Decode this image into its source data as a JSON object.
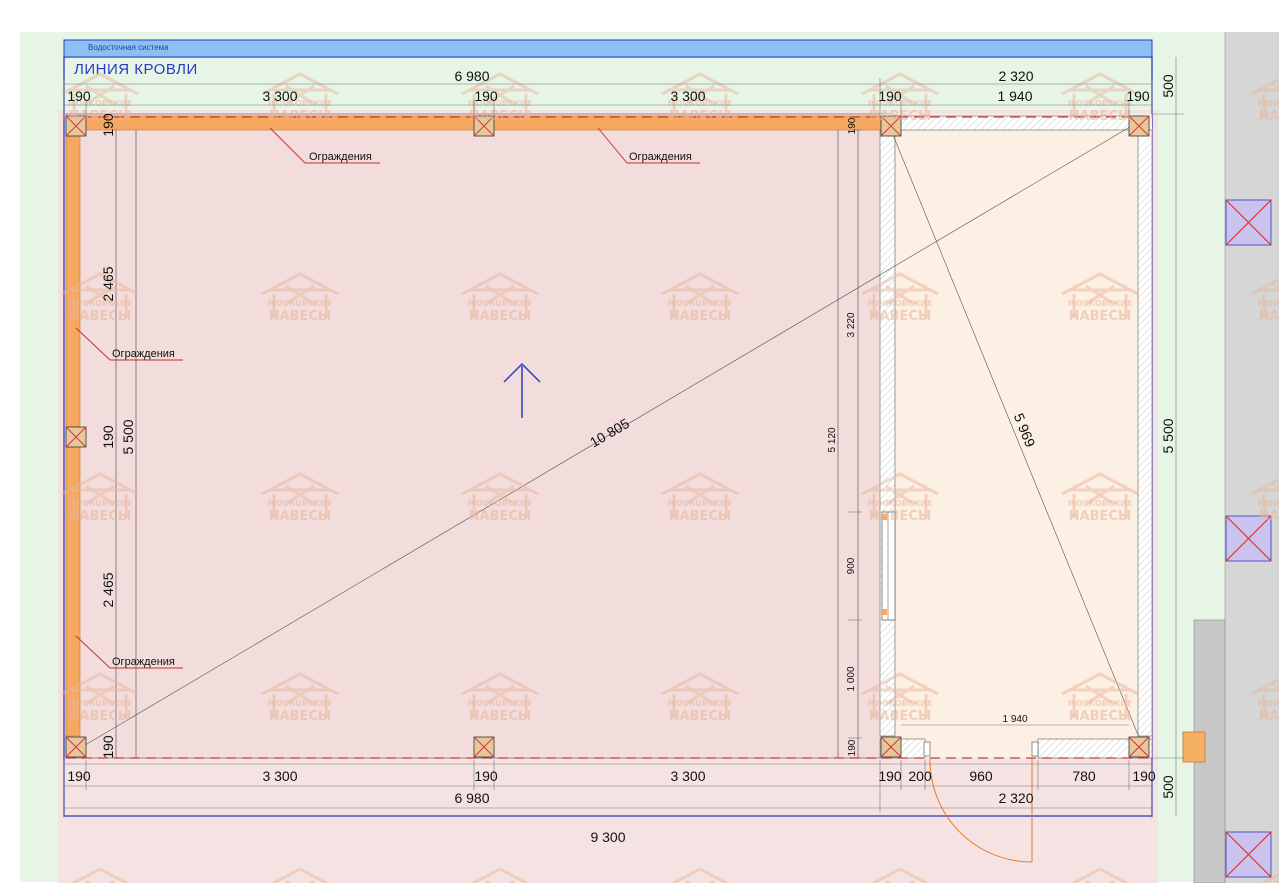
{
  "labels": {
    "gutter": "Водосточная система",
    "roof_line": "ЛИНИЯ КРОВЛИ",
    "fence": "Ограждения"
  },
  "watermark": {
    "line1": "МОСКОВСКИЕ",
    "line2": "НАВЕСЫ"
  },
  "dims": {
    "top_overall": "6 980",
    "top_room": "2 320",
    "top_190": "190",
    "top_span": "3 300",
    "top_room_inner": "1 940",
    "right_overhang": "500",
    "right_total": "5 500",
    "left_half": "2 465",
    "left_190": "190",
    "left_total": "5 500",
    "wall_3220": "3 220",
    "wall_5120": "5 120",
    "wall_900": "900",
    "wall_1000": "1 000",
    "wall_190": "190",
    "diag_main": "10 805",
    "diag_room": "5 969",
    "bottom_190": "190",
    "bottom_span": "3 300",
    "bottom_200": "200",
    "bottom_960": "960",
    "bottom_780": "780",
    "bottom_overall": "6 980",
    "bottom_room": "2 320",
    "bottom_total": "9 300",
    "bottom_overhang": "500",
    "room_inner": "1 940"
  },
  "colors": {
    "canopy_fill": "#f2dcdc",
    "room_fill": "#fcefe3",
    "beam": "#f6a760",
    "blue_line": "#2a3bc7",
    "red_cross": "#d23a3a",
    "green_bg": "#e6f5e6",
    "door_arc": "#f07a20"
  }
}
